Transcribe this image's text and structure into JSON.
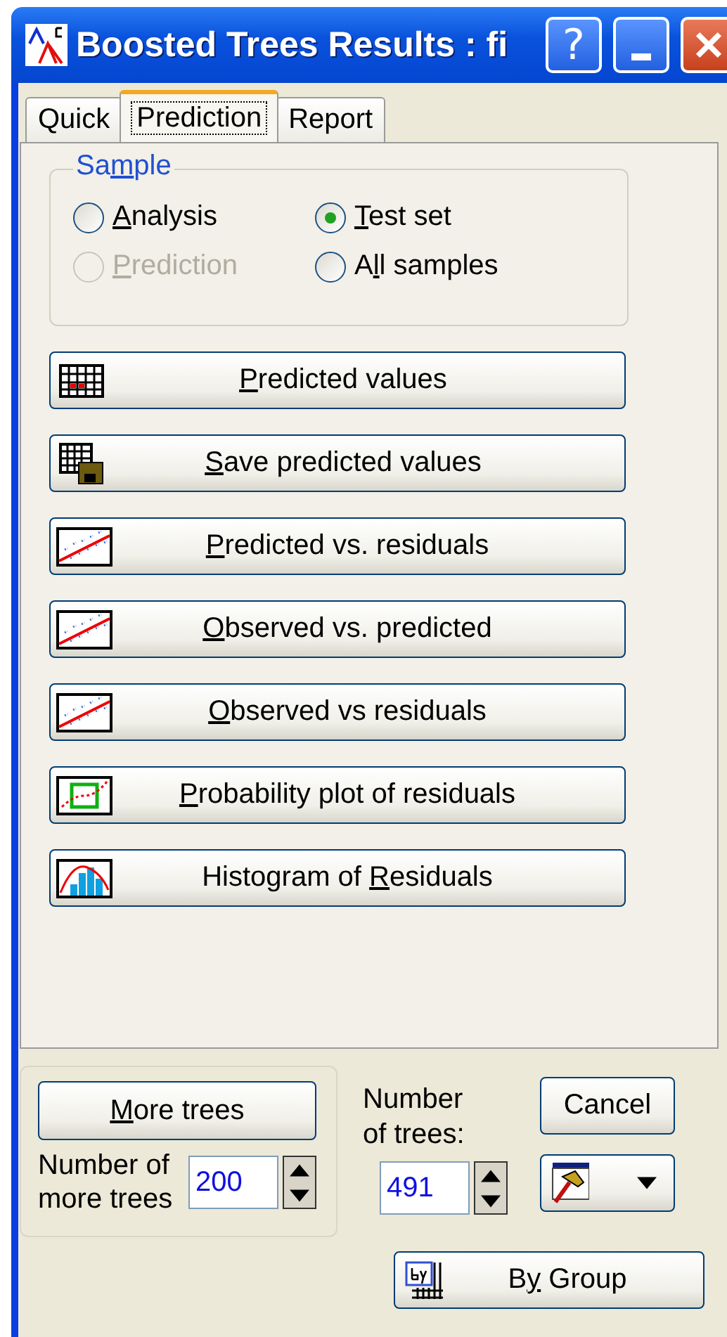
{
  "window": {
    "title": "Boosted Trees Results : fi",
    "controls": [
      {
        "kind": "help",
        "label": "?"
      },
      {
        "kind": "minimize"
      },
      {
        "kind": "close"
      }
    ]
  },
  "tabs": [
    {
      "label": "Quick",
      "selected": false
    },
    {
      "label": "Prediction",
      "selected": true
    },
    {
      "label": "Report",
      "selected": false
    }
  ],
  "sample": {
    "title": {
      "pre": "Sa",
      "key": "m",
      "post": "ple"
    },
    "options": [
      {
        "label": {
          "key": "A",
          "post": "nalysis"
        },
        "selected": false,
        "disabled": false
      },
      {
        "label": {
          "key": "T",
          "post": "est set"
        },
        "selected": true,
        "disabled": false
      },
      {
        "label": {
          "key": "P",
          "post": "rediction"
        },
        "selected": false,
        "disabled": true
      },
      {
        "label": {
          "pre": "A",
          "key": "l",
          "post": "l samples"
        },
        "selected": false,
        "disabled": false
      }
    ]
  },
  "actions": [
    {
      "kind": "spreadsheet",
      "label": {
        "key": "P",
        "post": "redicted values"
      }
    },
    {
      "kind": "save",
      "label": {
        "key": "S",
        "post": "ave predicted values"
      }
    },
    {
      "kind": "scatter",
      "label": {
        "key": "P",
        "post": "redicted vs. residuals"
      }
    },
    {
      "kind": "scatter",
      "label": {
        "key": "O",
        "post": "bserved vs. predicted"
      }
    },
    {
      "kind": "scatter",
      "label": {
        "key": "O",
        "post": "bserved vs residuals"
      }
    },
    {
      "kind": "probability",
      "label": {
        "key": "P",
        "post": "robability plot of residuals"
      }
    },
    {
      "kind": "histogram",
      "label": {
        "pre": "Histogram of ",
        "key": "R",
        "post": "esiduals"
      }
    }
  ],
  "more_trees": {
    "button": {
      "key": "M",
      "post": "ore trees"
    },
    "count_label": "Number of more trees",
    "count_value": "200"
  },
  "number_of_trees": {
    "label": "Number of trees:",
    "value": "491"
  },
  "cancel": "Cancel",
  "by_group": {
    "pre": "B",
    "key": "y",
    "post": " Group"
  }
}
